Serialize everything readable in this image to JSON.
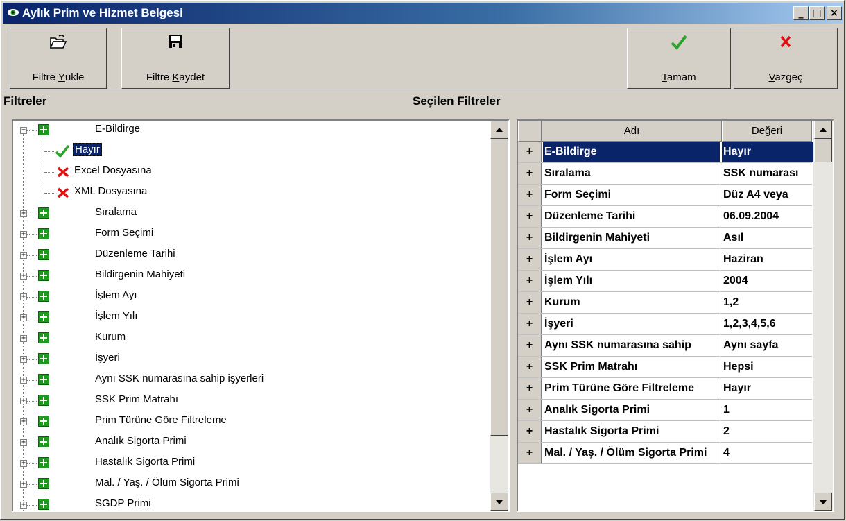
{
  "window": {
    "title": "Aylık Prim ve Hizmet Belgesi",
    "min": "_",
    "max": "□",
    "close": "×"
  },
  "toolbar": {
    "load_prefix": "Filtre ",
    "load_key": "Y",
    "load_suffix": "ükle",
    "save_prefix": "Filtre ",
    "save_key": "K",
    "save_suffix": "aydet",
    "ok_key": "T",
    "ok_suffix": "amam",
    "cancel_key": "V",
    "cancel_suffix": "azgeç"
  },
  "sections": {
    "filters": "Filtreler",
    "selected": "Seçilen Filtreler"
  },
  "tree": {
    "root": "E-Bildirge",
    "children": [
      "Hayır",
      "Excel Dosyasına",
      "XML Dosyasına"
    ],
    "items": [
      "Sıralama",
      "Form Seçimi",
      "Düzenleme Tarihi",
      "Bildirgenin Mahiyeti",
      "İşlem Ayı",
      "İşlem Yılı",
      "Kurum",
      "İşyeri",
      "Aynı SSK numarasına sahip işyerleri",
      "SSK Prim Matrahı",
      "Prim Türüne Göre Filtreleme",
      "Analık Sigorta Primi",
      "Hastalık Sigorta Primi",
      "Mal. / Yaş. / Ölüm Sigorta Primi",
      "SGDP Primi"
    ]
  },
  "grid": {
    "col_name": "Adı",
    "col_value": "Değeri",
    "row_indicator": "+",
    "rows": [
      {
        "name": "E-Bildirge",
        "value": "Hayır"
      },
      {
        "name": "Sıralama",
        "value": "SSK numarası"
      },
      {
        "name": "Form Seçimi",
        "value": "Düz A4 veya"
      },
      {
        "name": "Düzenleme Tarihi",
        "value": "06.09.2004"
      },
      {
        "name": "Bildirgenin Mahiyeti",
        "value": "Asıl"
      },
      {
        "name": "İşlem Ayı",
        "value": "Haziran"
      },
      {
        "name": "İşlem Yılı",
        "value": "2004"
      },
      {
        "name": "Kurum",
        "value": "1,2"
      },
      {
        "name": "İşyeri",
        "value": "1,2,3,4,5,6"
      },
      {
        "name": "Aynı SSK numarasına sahip",
        "value": "Aynı sayfa"
      },
      {
        "name": "SSK Prim Matrahı",
        "value": "Hepsi"
      },
      {
        "name": "Prim Türüne Göre Filtreleme",
        "value": "Hayır"
      },
      {
        "name": "Analık Sigorta Primi",
        "value": "1"
      },
      {
        "name": "Hastalık Sigorta Primi",
        "value": "2"
      },
      {
        "name": "Mal. / Yaş. / Ölüm Sigorta Primi",
        "value": "4"
      }
    ]
  }
}
